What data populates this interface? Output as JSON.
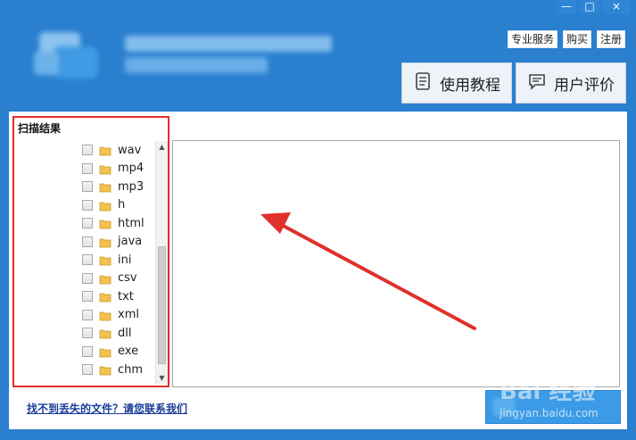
{
  "window": {
    "controls": {
      "minimize": "—",
      "maximize": "□",
      "close": "×"
    }
  },
  "header": {
    "links": {
      "pro_service": "专业服务",
      "buy": "购买",
      "register": "注册"
    },
    "buttons": {
      "tutorial": "使用教程",
      "user_review": "用户评价"
    }
  },
  "scan": {
    "title": "扫描结果",
    "items": [
      {
        "label": "wav"
      },
      {
        "label": "mp4"
      },
      {
        "label": "mp3"
      },
      {
        "label": "h"
      },
      {
        "label": "html"
      },
      {
        "label": "java"
      },
      {
        "label": "ini"
      },
      {
        "label": "csv"
      },
      {
        "label": "txt"
      },
      {
        "label": "xml"
      },
      {
        "label": "dll"
      },
      {
        "label": "exe"
      },
      {
        "label": "chm"
      }
    ]
  },
  "footer": {
    "help_link": "找不到丢失的文件？请您联系我们"
  },
  "watermark": {
    "brand": "Bai 经验",
    "url": "jingyan.baidu.com"
  },
  "colors": {
    "frame_blue": "#2a7fcf",
    "highlight_red": "#e0302c"
  }
}
